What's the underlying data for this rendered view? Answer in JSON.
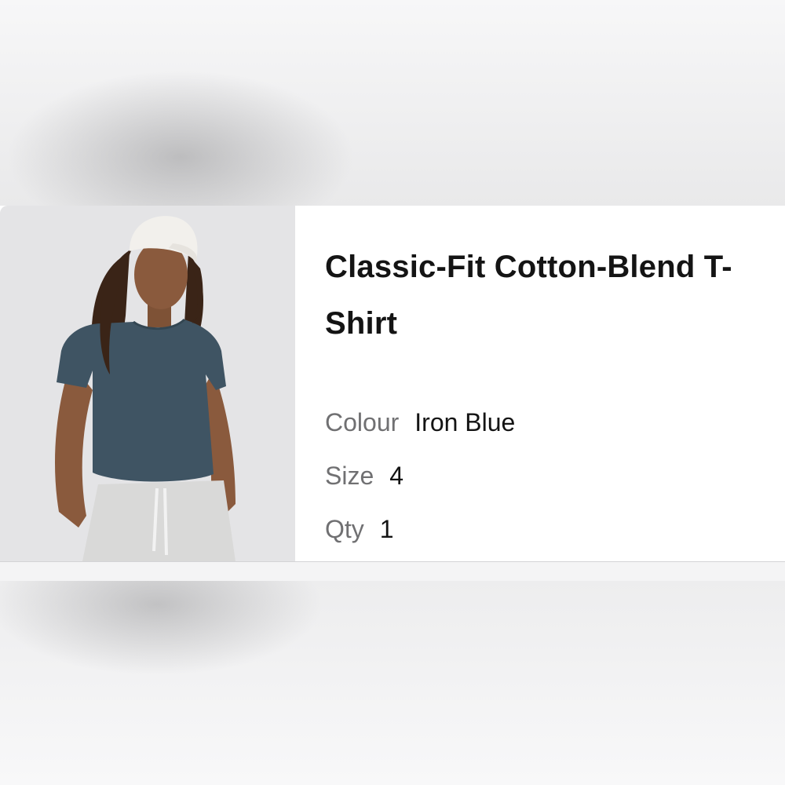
{
  "product": {
    "title": "Classic-Fit Cotton-Blend T-Shirt",
    "image_alt_icon": "product-photo",
    "attributes": [
      {
        "label": "Colour",
        "value": "Iron Blue"
      },
      {
        "label": "Size",
        "value": "4"
      },
      {
        "label": "Qty",
        "value": "1"
      }
    ]
  },
  "colors": {
    "shirt": "#3f5463",
    "cap": "#f2f0ec",
    "pants": "#d9d9d8",
    "skin": "#8a5a3d",
    "hair": "#3a2417"
  }
}
